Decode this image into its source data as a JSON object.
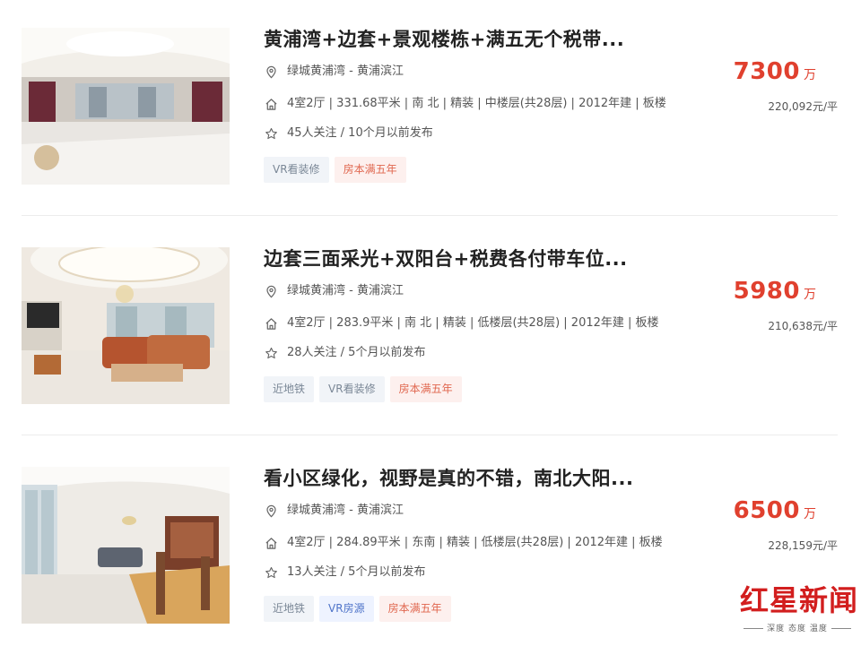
{
  "listings": [
    {
      "title": "黄浦湾+边套+景观楼栋+满五无个税带...",
      "location": "绿城黄浦湾 - 黄浦滨江",
      "info": "4室2厅 | 331.68平米 | 南 北 | 精装 | 中楼层(共28层) | 2012年建 | 板楼",
      "follow": "45人关注 / 10个月以前发布",
      "price": "7300",
      "price_unit": "万",
      "unit_price": "220,092元/平",
      "tags": [
        {
          "label": "VR看装修",
          "style": "gray"
        },
        {
          "label": "房本满五年",
          "style": "red"
        }
      ]
    },
    {
      "title": "边套三面采光+双阳台+税费各付带车位...",
      "location": "绿城黄浦湾 - 黄浦滨江",
      "info": "4室2厅 | 283.9平米 | 南 北 | 精装 | 低楼层(共28层) | 2012年建 | 板楼",
      "follow": "28人关注 / 5个月以前发布",
      "price": "5980",
      "price_unit": "万",
      "unit_price": "210,638元/平",
      "tags": [
        {
          "label": "近地铁",
          "style": "gray"
        },
        {
          "label": "VR看装修",
          "style": "gray"
        },
        {
          "label": "房本满五年",
          "style": "red"
        }
      ]
    },
    {
      "title": "看小区绿化，视野是真的不错，南北大阳...",
      "location": "绿城黄浦湾 - 黄浦滨江",
      "info": "4室2厅 | 284.89平米 | 东南 | 精装 | 低楼层(共28层) | 2012年建 | 板楼",
      "follow": "13人关注 / 5个月以前发布",
      "price": "6500",
      "price_unit": "万",
      "unit_price": "228,159元/平",
      "tags": [
        {
          "label": "近地铁",
          "style": "gray"
        },
        {
          "label": "VR房源",
          "style": "blue"
        },
        {
          "label": "房本满五年",
          "style": "red"
        }
      ]
    }
  ],
  "icons": {
    "location": "location-pin-icon",
    "house": "house-icon",
    "star": "star-icon"
  },
  "colors": {
    "price": "#e0402e",
    "tag_gray_bg": "#f1f4f8",
    "tag_blue_bg": "#eef3ff",
    "tag_red_bg": "#fdf0ee"
  },
  "watermark": {
    "main": "红星新闻",
    "sub": "深度 态度 温度"
  }
}
